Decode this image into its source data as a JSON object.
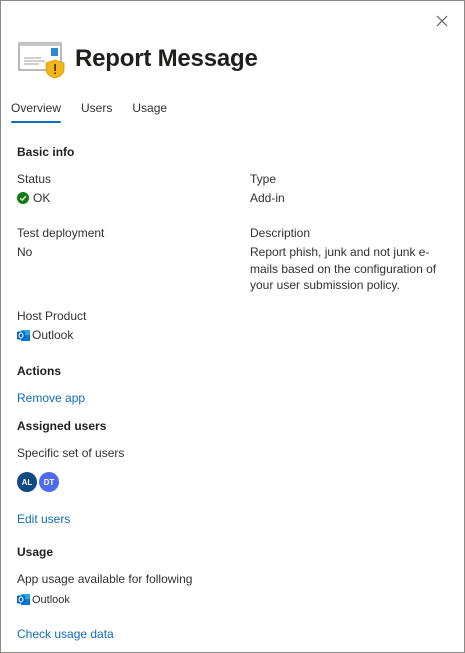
{
  "header": {
    "title": "Report Message",
    "app_icon": "report-message-envelope-icon",
    "close_icon": "close-icon"
  },
  "tabs": [
    {
      "label": "Overview",
      "active": true
    },
    {
      "label": "Users",
      "active": false
    },
    {
      "label": "Usage",
      "active": false
    }
  ],
  "basic_info": {
    "heading": "Basic info",
    "status_label": "Status",
    "status_value": "OK",
    "type_label": "Type",
    "type_value": "Add-in",
    "test_deployment_label": "Test deployment",
    "test_deployment_value": "No",
    "description_label": "Description",
    "description_value": "Report phish, junk and not junk e-mails based on the configuration of your user submission policy.",
    "host_product_label": "Host Product",
    "host_product_value": "Outlook"
  },
  "actions": {
    "heading": "Actions",
    "remove_app": "Remove app"
  },
  "assigned_users": {
    "heading": "Assigned users",
    "scope": "Specific set of users",
    "avatars": [
      {
        "initials": "AL",
        "color": "#0f4a85"
      },
      {
        "initials": "DT",
        "color": "#4f6bed"
      }
    ],
    "edit_users": "Edit users"
  },
  "usage": {
    "heading": "Usage",
    "description": "App usage available for following",
    "product": "Outlook",
    "check_usage": "Check usage data"
  },
  "colors": {
    "link": "#0f6cbd",
    "ok_green": "#107c10",
    "outlook_blue": "#0364b8"
  }
}
